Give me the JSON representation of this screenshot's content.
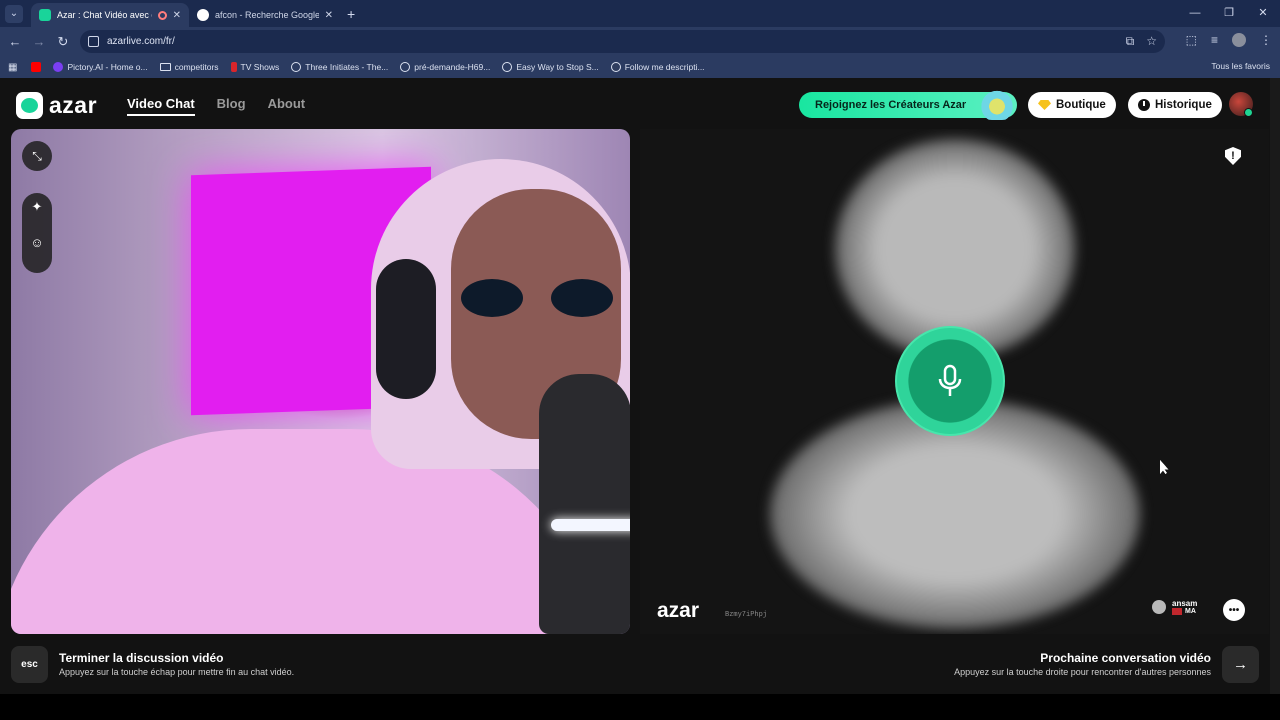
{
  "browser": {
    "tabs": [
      {
        "title": "Azar : Chat Vidéo avec de n",
        "active": true
      },
      {
        "title": "afcon - Recherche Google",
        "active": false
      }
    ],
    "url": "azarlive.com/fr/",
    "bookmarks": [
      {
        "label": "",
        "icon": "youtube-icon"
      },
      {
        "label": "Pictory.AI - Home o...",
        "icon": "pictory-icon"
      },
      {
        "label": "competitors",
        "icon": "folder-icon"
      },
      {
        "label": "TV Shows",
        "icon": "bookmark-icon"
      },
      {
        "label": "Three Initiates - The...",
        "icon": "globe-icon"
      },
      {
        "label": "pré-demande-H69...",
        "icon": "globe-icon"
      },
      {
        "label": "Easy Way to Stop S...",
        "icon": "globe-icon"
      },
      {
        "label": "Follow me descripti...",
        "icon": "globe-icon"
      }
    ],
    "bookmarks_right": "Tous les favoris"
  },
  "header": {
    "logo_text": "azar",
    "nav": [
      {
        "label": "Video Chat",
        "active": true
      },
      {
        "label": "Blog",
        "active": false
      },
      {
        "label": "About",
        "active": false
      }
    ],
    "creators_cta": "Rejoignez les Créateurs Azar",
    "shop_label": "Boutique",
    "history_label": "Historique"
  },
  "remote": {
    "watermark": "azar",
    "watermark_id": "Bzmy7iPhpj",
    "peer_name": "ansam",
    "peer_country": "MA"
  },
  "footer": {
    "esc_key": "esc",
    "end_title": "Terminer la discussion vidéo",
    "end_subtitle": "Appuyez sur la touche échap pour mettre fin au chat vidéo.",
    "next_title": "Prochaine conversation vidéo",
    "next_subtitle": "Appuyez sur la touche droite pour rencontrer d'autres personnes",
    "next_key": "→"
  },
  "colors": {
    "accent": "#19e6a0",
    "mic_active": "#149e6c",
    "browser_chrome": "#1b2a4e",
    "page_bg": "#121212"
  }
}
